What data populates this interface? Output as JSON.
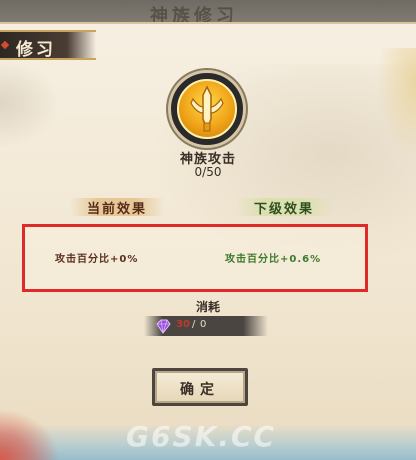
{
  "window": {
    "title": "修习",
    "background_title": "神族修习"
  },
  "skill": {
    "icon": "sword-emblem-icon",
    "name": "神族攻击",
    "level": "0/50"
  },
  "effects": {
    "current_header": "当前效果",
    "next_header": "下级效果",
    "current_value": "攻击百分比+0%",
    "next_value": "攻击百分比+0.6%"
  },
  "consume": {
    "label": "消耗",
    "item_icon": "purple-gem-icon",
    "owned": "30",
    "separator": "/",
    "required": "0"
  },
  "actions": {
    "confirm_label": "确定"
  },
  "watermark": "G6SK.CC",
  "colors": {
    "highlight_box": "#e02a2a",
    "next_effect": "#3c7a2a",
    "current_effect": "#5a2f1e",
    "skill_gold": "#f0a418"
  }
}
